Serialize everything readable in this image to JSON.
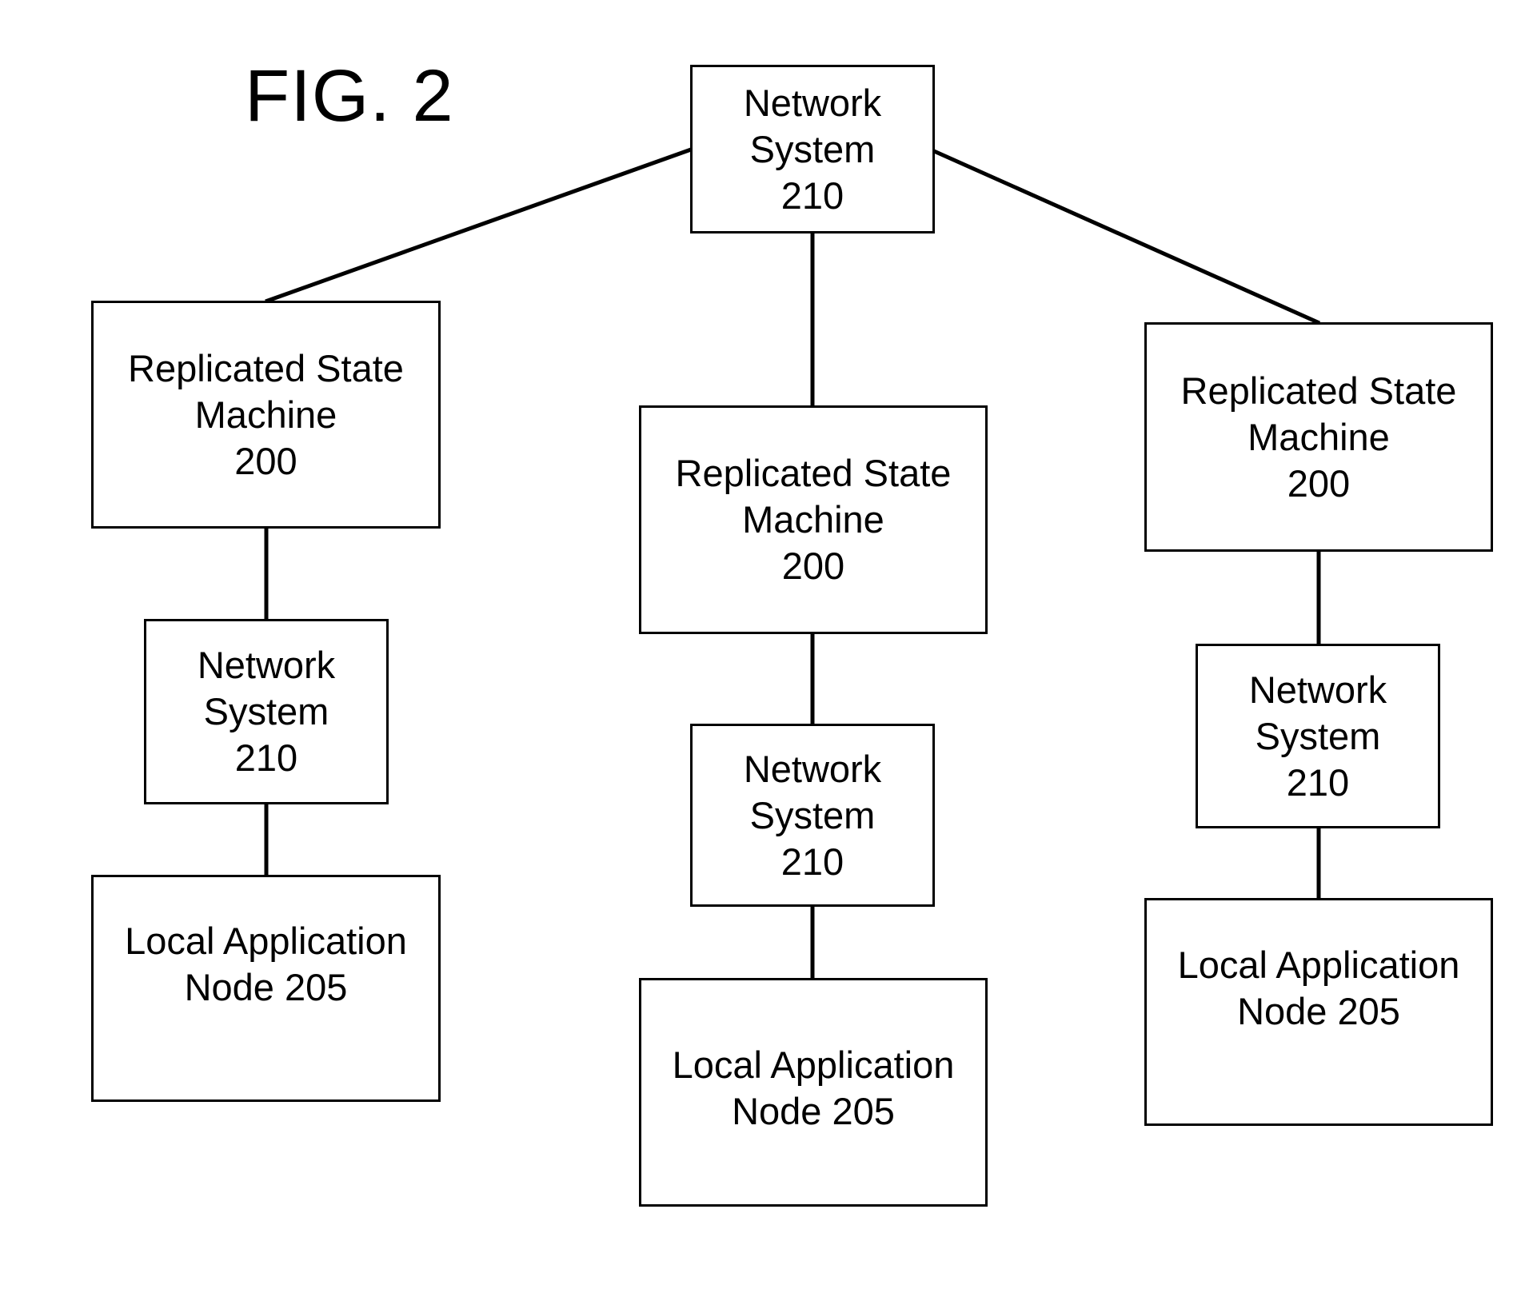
{
  "figure": {
    "label": "FIG. 2"
  },
  "nodes": {
    "top_network": {
      "title": "Network\nSystem\n210",
      "type": "Network System",
      "ref": "210"
    },
    "left_rsm": {
      "title": "Replicated State\nMachine\n200",
      "type": "Replicated State Machine",
      "ref": "200"
    },
    "mid_rsm": {
      "title": "Replicated State\nMachine\n200",
      "type": "Replicated State Machine",
      "ref": "200"
    },
    "right_rsm": {
      "title": "Replicated State\nMachine\n200",
      "type": "Replicated State Machine",
      "ref": "200"
    },
    "left_network": {
      "title": "Network\nSystem\n210",
      "type": "Network System",
      "ref": "210"
    },
    "mid_network": {
      "title": "Network\nSystem\n210",
      "type": "Network System",
      "ref": "210"
    },
    "right_network": {
      "title": "Network\nSystem\n210",
      "type": "Network System",
      "ref": "210"
    },
    "left_lan": {
      "title": "Local Application\nNode 205",
      "type": "Local Application Node",
      "ref": "205"
    },
    "mid_lan": {
      "title": "Local Application\nNode 205",
      "type": "Local Application Node",
      "ref": "205"
    },
    "right_lan": {
      "title": "Local Application\nNode 205",
      "type": "Local Application Node",
      "ref": "205"
    }
  },
  "edges": [
    [
      "top_network",
      "left_rsm"
    ],
    [
      "top_network",
      "mid_rsm"
    ],
    [
      "top_network",
      "right_rsm"
    ],
    [
      "left_rsm",
      "left_network"
    ],
    [
      "left_network",
      "left_lan"
    ],
    [
      "mid_rsm",
      "mid_network"
    ],
    [
      "mid_network",
      "mid_lan"
    ],
    [
      "right_rsm",
      "right_network"
    ],
    [
      "right_network",
      "right_lan"
    ]
  ]
}
